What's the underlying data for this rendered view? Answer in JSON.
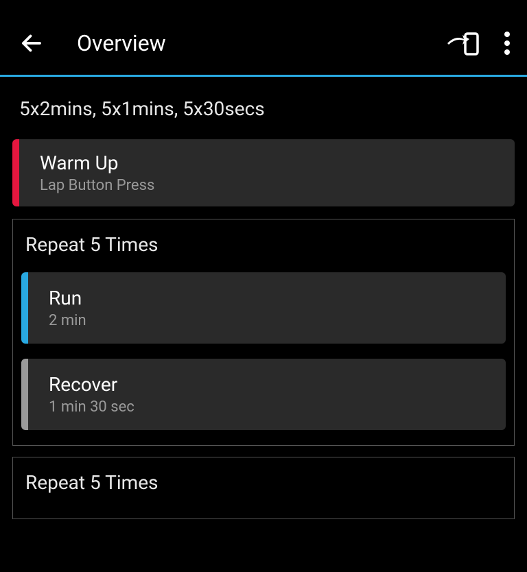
{
  "header": {
    "title": "Overview"
  },
  "workout": {
    "summary": "5x2mins, 5x1mins, 5x30secs"
  },
  "warmup": {
    "title": "Warm Up",
    "subtitle": "Lap Button Press"
  },
  "group1": {
    "label": "Repeat 5 Times",
    "run": {
      "title": "Run",
      "subtitle": "2 min"
    },
    "recover": {
      "title": "Recover",
      "subtitle": "1 min 30 sec"
    }
  },
  "group2": {
    "label": "Repeat 5 Times"
  }
}
